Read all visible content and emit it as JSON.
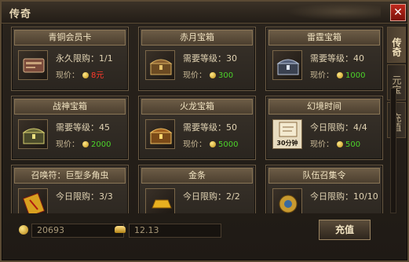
{
  "window": {
    "title": "传奇",
    "close_label": "✕"
  },
  "side_tabs": [
    {
      "label": "传奇",
      "active": true
    },
    {
      "label": "元宝",
      "active": false
    },
    {
      "label": "充值",
      "active": false
    }
  ],
  "items": [
    {
      "name": "青铜会员卡",
      "line1": "永久限购：1/1",
      "price_label": "现价：",
      "price": "8元",
      "price_color": "red",
      "icon": "card-icon"
    },
    {
      "name": "赤月宝箱",
      "line1": "需要等级：30",
      "price_label": "现价：",
      "price": "300",
      "price_color": "green",
      "icon": "chest-icon"
    },
    {
      "name": "雷霆宝箱",
      "line1": "需要等级：40",
      "price_label": "现价：",
      "price": "1000",
      "price_color": "green",
      "icon": "chest-icon"
    },
    {
      "name": "战神宝箱",
      "line1": "需要等级：45",
      "price_label": "现价：",
      "price": "2000",
      "price_color": "green",
      "icon": "chest-icon"
    },
    {
      "name": "火龙宝箱",
      "line1": "需要等级：50",
      "price_label": "现价：",
      "price": "5000",
      "price_color": "green",
      "icon": "chest-icon"
    },
    {
      "name": "幻境时间",
      "line1": "今日限购：4/4",
      "price_label": "现价：",
      "price": "500",
      "price_color": "green",
      "icon": "scroll-icon",
      "icon_text": "30分钟"
    },
    {
      "name": "召唤符：巨型多角虫",
      "line1": "今日限购：3/3",
      "price_label": "",
      "price": "",
      "price_color": "green",
      "icon": "talisman-icon"
    },
    {
      "name": "金条",
      "line1": "今日限购：2/2",
      "price_label": "",
      "price": "",
      "price_color": "green",
      "icon": "gold-bar-icon"
    },
    {
      "name": "队伍召集令",
      "line1": "今日限购：10/10",
      "price_label": "",
      "price": "",
      "price_color": "green",
      "icon": "summon-order-icon"
    }
  ],
  "footer": {
    "gold_value": "20693",
    "ingot_value": "12.13",
    "recharge_label": "充值"
  },
  "colors": {
    "price_red": "#ff3a2a",
    "price_green": "#4cd42a",
    "close_red": "#c0281c"
  }
}
